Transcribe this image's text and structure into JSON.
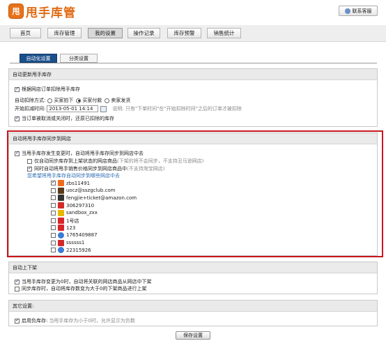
{
  "app": {
    "logo_text": "甩手库管",
    "logo_mark": "甩",
    "support_label": "联系客服"
  },
  "nav": {
    "tabs": [
      {
        "label": "首页"
      },
      {
        "label": "库存管理"
      },
      {
        "label": "我的设置",
        "active": true
      },
      {
        "label": "操作记录"
      },
      {
        "label": "库存预警"
      },
      {
        "label": "销售统计"
      }
    ]
  },
  "subtabs": [
    {
      "label": "自动化设置",
      "active": true
    },
    {
      "label": "分类设置"
    }
  ],
  "auto_update": {
    "title": "自动更新甩手库存",
    "deduct_by_order": "根据网店订单扣除甩手库存",
    "method_label": "自动扣除方式:",
    "methods": [
      "买家拍下",
      "买家付款",
      "卖家发货"
    ],
    "selected_method": "买家付款",
    "start_time_label": "开始扣减时间:",
    "start_time_value": "2013-05-01 14:14",
    "note": "说明: 只有\"下单时间\"在\"开始扣除时间\"之后的订单才被扣除",
    "restore_label": "当订单被取消或关闭时，还原已扣除的库存"
  },
  "sync": {
    "title": "自动将甩手库存同步到网店",
    "main_label": "当甩手库存发生变更时，自动将甩手库存同步到网店中去",
    "only_shelf_label": "仅自动同步库存到上架状态的网店商品",
    "only_shelf_note": "(下架的将不会同步，不支持丑马逊网店)",
    "price_label": "同时自动将甩手销售价格同步到网店商品中",
    "price_note": "(不支持淘宝网店)",
    "choose_label": "您希望将甩手库存自动同步到哪些网店中去",
    "shops": [
      {
        "name": "zbs11491",
        "checked": true,
        "icon": "taobao-shop-icon",
        "color": "#f26b1d"
      },
      {
        "name": "uocz@sszgclub.com",
        "checked": false,
        "icon": "paipai-shop-icon",
        "color": "#5a3a1a"
      },
      {
        "name": "fengjie+ticket@amazon.com",
        "checked": false,
        "icon": "amazon-shop-icon",
        "color": "#333333"
      },
      {
        "name": "306297310",
        "checked": false,
        "icon": "dangdang-shop-icon",
        "color": "#d22a2a"
      },
      {
        "name": "sandbox_zxx",
        "checked": false,
        "icon": "alibaba-shop-icon",
        "color": "#e6b800"
      },
      {
        "name": "1号店",
        "checked": false,
        "icon": "yhd-shop-icon",
        "color": "#d8242a"
      },
      {
        "name": "123",
        "checked": false,
        "icon": "yhd-shop-icon",
        "color": "#d8242a"
      },
      {
        "name": "1765409887",
        "checked": false,
        "icon": "globe-shop-icon",
        "color": "#3a7bd5"
      },
      {
        "name": "ssssss1",
        "checked": false,
        "icon": "dangdang-shop-icon",
        "color": "#d22a2a"
      },
      {
        "name": "22315926",
        "checked": false,
        "icon": "globe-shop-icon",
        "color": "#3a7bd5"
      }
    ]
  },
  "shelf": {
    "title": "自动上下架",
    "opt1": "当甩手库存变更为0时，自动将关联的网店商品从网店中下架",
    "opt2": "同步库存时，自动将库存数变为大于0的下架商品进行上架"
  },
  "other": {
    "title": "其它设置:",
    "negative_label": "启用负库存:",
    "negative_note": "当甩手库存为小于0时，允许显示为负数"
  },
  "save_label": "保存设置"
}
